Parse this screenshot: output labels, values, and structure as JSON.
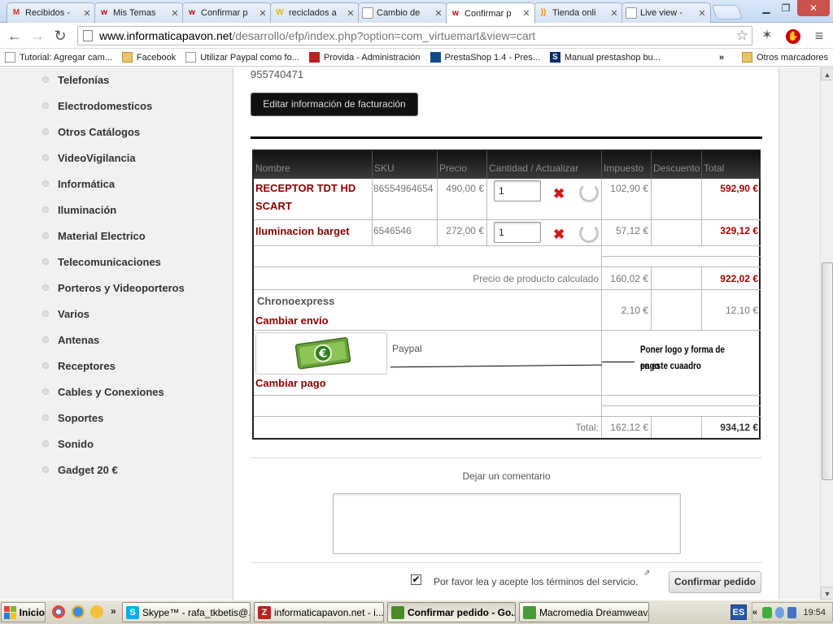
{
  "browser": {
    "tabs": [
      {
        "label": "Recibidos -",
        "icon": "M",
        "icon_color": "#d93025"
      },
      {
        "label": "Mis Temas",
        "icon": "w",
        "icon_color": "#cc0000"
      },
      {
        "label": "Confirmar p",
        "icon": "w",
        "icon_color": "#cc0000"
      },
      {
        "label": "reciclados a",
        "icon": "W",
        "icon_color": "#e6b800"
      },
      {
        "label": "Cambio de",
        "icon": "",
        "icon_color": "#999999"
      },
      {
        "label": "Confirmar p",
        "icon": "w",
        "icon_color": "#cc0000",
        "active": true
      },
      {
        "label": "Tienda onli",
        "icon": "))",
        "icon_color": "#ff8800"
      },
      {
        "label": "Live view -",
        "icon": "",
        "icon_color": "#999999"
      }
    ],
    "url_host": "www.informaticapavon.net",
    "url_path": "/desarrollo/efp/index.php?option=com_virtuemart&view=cart",
    "bookmarks": [
      {
        "label": "Tutorial: Agregar cam...",
        "icon": "page"
      },
      {
        "label": "Facebook",
        "icon": "folder"
      },
      {
        "label": "Utilizar Paypal como fo...",
        "icon": "page"
      },
      {
        "label": "Provida - Administración",
        "icon": "red"
      },
      {
        "label": "PrestaShop 1.4 - Pres...",
        "icon": "blue"
      },
      {
        "label": "Manual prestashop bu...",
        "icon": "s"
      }
    ],
    "bookmarks_more": "»",
    "other_bookmarks": "Otros marcadores"
  },
  "sidebar": {
    "categories": [
      "Telefonías",
      "Electrodomesticos",
      "Otros Catálogos",
      "VideoVigilancia",
      "Informática",
      "Iluminación",
      "Material Electrico",
      "Telecomunicaciones",
      "Porteros y Videoporteros",
      "Varios",
      "Antenas",
      "Receptores",
      "Cables y Conexiones",
      "Soportes",
      "Sonido",
      "Gadget 20 €"
    ]
  },
  "page": {
    "phone": "955740471",
    "edit_billing_label": "Editar información de facturación"
  },
  "cart": {
    "columns": [
      "Nombre",
      "SKU",
      "Precio",
      "Cantidad / Actualizar",
      "Impuesto",
      "Descuento",
      "Total"
    ],
    "items": [
      {
        "name_line1": "RECEPTOR TDT HD",
        "name_line2": "SCART",
        "sku": "86554964654",
        "price": "490,00 €",
        "qty": "1",
        "tax": "102,90 €",
        "discount": "",
        "total": "592,90 €"
      },
      {
        "name_line1": "Iluminacion barget",
        "name_line2": "",
        "sku": "6546546",
        "price": "272,00 €",
        "qty": "1",
        "tax": "57,12 €",
        "discount": "",
        "total": "329,12 €"
      }
    ],
    "subtotal_label": "Precio de producto calculado",
    "subtotal_tax": "160,02 €",
    "subtotal_total": "922,02 €",
    "shipping_name": "Chronoexpress",
    "shipping_change": "Cambiar envío",
    "shipping_tax": "2,10 €",
    "shipping_total": "12,10 €",
    "payment_name": "Paypal",
    "payment_change": "Cambiar pago",
    "payment_note_line1": "Poner logo y forma de pago",
    "payment_note_line2": "en este cuaadro",
    "total_label": "Total:",
    "total_tax": "162,12 €",
    "total_total": "934,12 €"
  },
  "comment": {
    "label": "Dejar un comentario",
    "value": ""
  },
  "terms": {
    "checked": "✔",
    "label": "Por favor lea y acepte los términos del servicio.",
    "link_icon": "⇗"
  },
  "confirm_label": "Confirmar pedido",
  "taskbar": {
    "start_label": "Inicio",
    "quicklaunch_more": "»",
    "tasks": [
      {
        "label": "Skype™ - rafa_tkbetis@...",
        "icon": "S",
        "icon_color": "#00aff0"
      },
      {
        "label": "informaticapavon.net - i...",
        "icon": "Z",
        "icon_color": "#c02020"
      },
      {
        "label": "Confirmar pedido - Go...",
        "icon": "",
        "icon_color": "#4a8a2a",
        "active": true
      },
      {
        "label": "Macromedia Dreamweav...",
        "icon": "",
        "icon_color": "#4a9a3a"
      }
    ],
    "language": "ES",
    "tray_more": "«",
    "clock": "19:54"
  }
}
